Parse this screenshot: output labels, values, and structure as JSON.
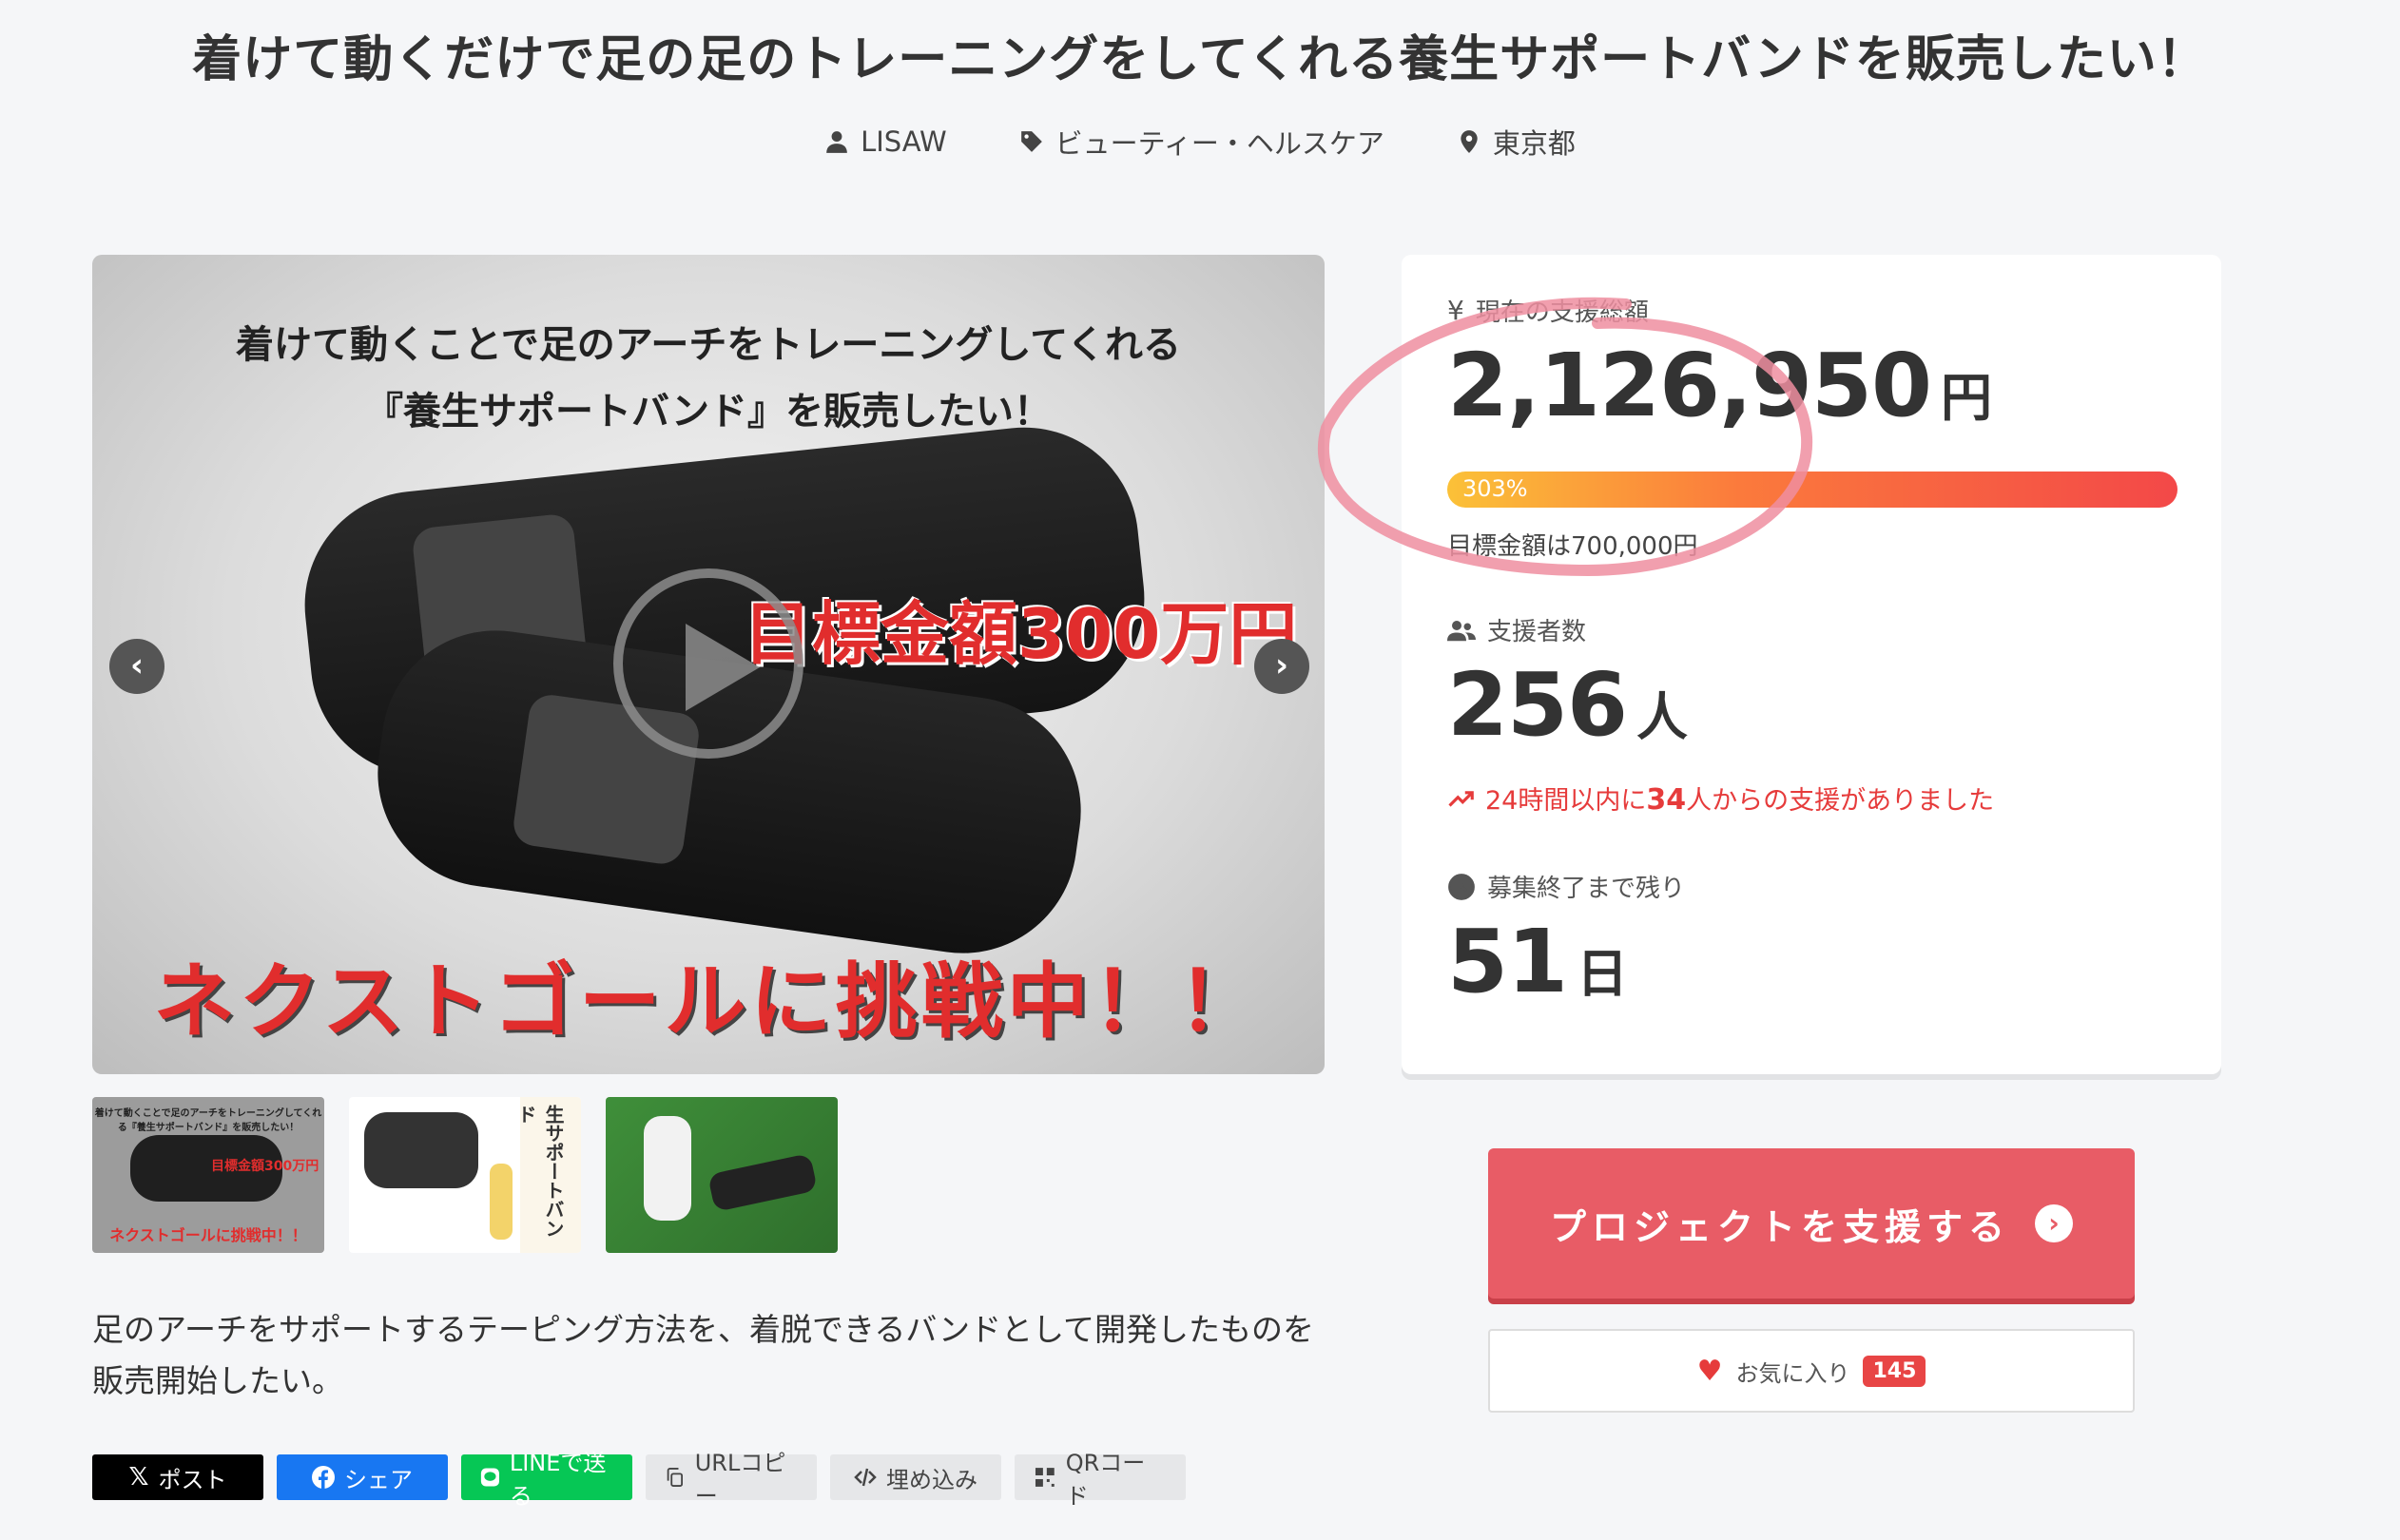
{
  "project": {
    "title": "着けて動くだけで足の足のトレーニングをしてくれる養生サポートバンドを販売したい！",
    "owner": "LISAW",
    "category": "ビューティー・ヘルスケア",
    "location": "東京都",
    "description": "足のアーチをサポートするテーピング方法を、着脱できるバンドとして開発したものを販売開始したい。"
  },
  "hero": {
    "caption_line1": "着けて動くことで足のアーチをトレーニングしてくれる",
    "caption_line2": "『養生サポートバンド』を販売したい！",
    "goal_text": "目標金額300万円",
    "next_text": "ネクストゴールに挑戦中！！"
  },
  "thumbnails": {
    "t1_top": "着けて動くことで足のアーチをトレーニングしてくれる『養生サポートバンド』を販売したい！",
    "t1_goal": "目標金額300万円",
    "t1_next": "ネクストゴールに挑戦中！！",
    "t2_vertical": "生サポートバンド"
  },
  "stats": {
    "total_label": "現在の支援総額",
    "total_value": "2,126,950",
    "total_unit": "円",
    "progress_percent": 303,
    "progress_label": "303%",
    "target_text": "目標金額は700,000円",
    "backers_label": "支援者数",
    "backers_value": "256",
    "backers_unit": "人",
    "trend_prefix": "24時間以内に",
    "trend_count": "34",
    "trend_suffix": "人からの支援がありました",
    "remaining_label": "募集終了まで残り",
    "remaining_value": "51",
    "remaining_unit": "日"
  },
  "actions": {
    "support_label": "プロジェクトを支援する",
    "favorite_label": "お気に入り",
    "favorite_count": "145"
  },
  "share": {
    "x_label": "ポスト",
    "fb_label": "シェア",
    "line_label": "LINEで送る",
    "url_label": "URLコピー",
    "embed_label": "埋め込み",
    "qr_label": "QRコード"
  },
  "colors": {
    "accent": "#e85c66",
    "trend": "#e63b3b",
    "x": "#000000",
    "facebook": "#1877f2",
    "line": "#06c755"
  }
}
